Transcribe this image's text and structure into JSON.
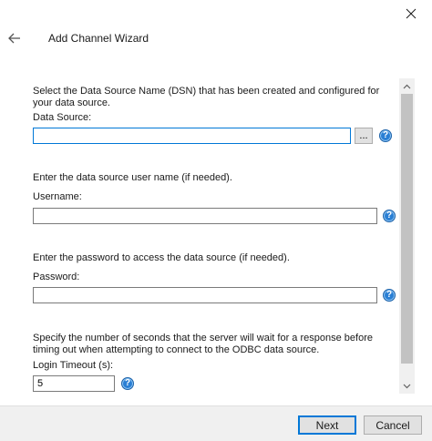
{
  "window": {
    "title": "Add Channel Wizard"
  },
  "sections": {
    "data_source": {
      "description": "Select the Data Source Name (DSN) that has been created and configured for your data source.",
      "label": "Data Source:",
      "value": "",
      "browse_label": "..."
    },
    "username": {
      "description": "Enter the data source user name (if needed).",
      "label": "Username:",
      "value": ""
    },
    "password": {
      "description": "Enter the password to access the data source (if needed).",
      "label": "Password:",
      "value": ""
    },
    "login_timeout": {
      "description": "Specify the number of seconds that the server will wait for a response before timing out when attempting to connect to the ODBC data source.",
      "label": "Login Timeout (s):",
      "value": "5"
    }
  },
  "help_glyph": "?",
  "footer": {
    "next_label": "Next",
    "cancel_label": "Cancel"
  },
  "colors": {
    "accent": "#0078d7",
    "help_icon": "#2a7fd4"
  }
}
